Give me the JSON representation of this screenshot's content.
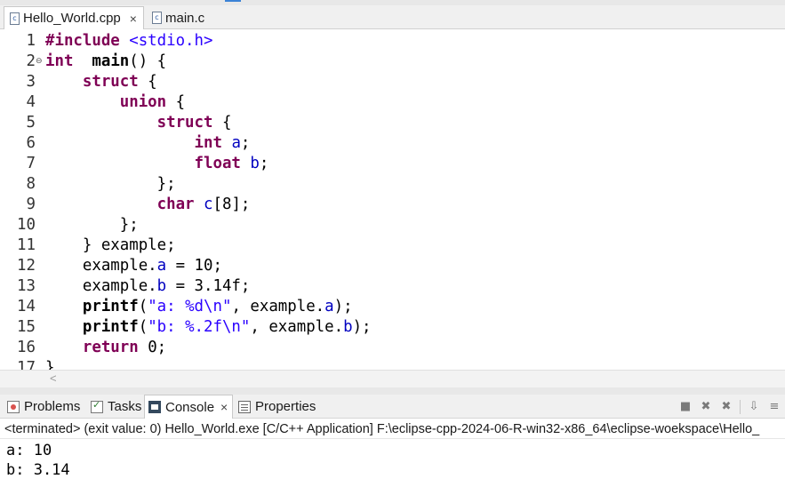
{
  "editor_tabs": [
    {
      "label": "Hello_World.cpp",
      "icon": "c-source-file-icon",
      "active": true
    },
    {
      "label": "main.c",
      "icon": "c-source-file-icon",
      "active": false
    }
  ],
  "tab_icon_glyph": "c",
  "tab_close_glyph": "×",
  "code": [
    {
      "n": "1",
      "tokens": [
        [
          "pp",
          "#include "
        ],
        [
          "str",
          "<stdio.h>"
        ]
      ]
    },
    {
      "n": "2",
      "fold": "⊖",
      "tokens": [
        [
          "kw",
          "int"
        ],
        [
          "",
          "  "
        ],
        [
          "fn",
          "main"
        ],
        [
          "",
          "() {"
        ]
      ]
    },
    {
      "n": "3",
      "tokens": [
        [
          "",
          "    "
        ],
        [
          "kw",
          "struct"
        ],
        [
          "",
          " {"
        ]
      ]
    },
    {
      "n": "4",
      "tokens": [
        [
          "",
          "        "
        ],
        [
          "kw",
          "union"
        ],
        [
          "",
          " {"
        ]
      ]
    },
    {
      "n": "5",
      "tokens": [
        [
          "",
          "            "
        ],
        [
          "kw",
          "struct"
        ],
        [
          "",
          " {"
        ]
      ]
    },
    {
      "n": "6",
      "tokens": [
        [
          "",
          "                "
        ],
        [
          "kw",
          "int"
        ],
        [
          "",
          " "
        ],
        [
          "fld",
          "a"
        ],
        [
          "",
          ";"
        ]
      ]
    },
    {
      "n": "7",
      "tokens": [
        [
          "",
          "                "
        ],
        [
          "kw",
          "float"
        ],
        [
          "",
          " "
        ],
        [
          "fld",
          "b"
        ],
        [
          "",
          ";"
        ]
      ]
    },
    {
      "n": "8",
      "tokens": [
        [
          "",
          "            };"
        ]
      ]
    },
    {
      "n": "9",
      "tokens": [
        [
          "",
          "            "
        ],
        [
          "kw",
          "char"
        ],
        [
          "",
          " "
        ],
        [
          "fld",
          "c"
        ],
        [
          "",
          "[8];"
        ]
      ]
    },
    {
      "n": "10",
      "tokens": [
        [
          "",
          "        };"
        ]
      ]
    },
    {
      "n": "11",
      "tokens": [
        [
          "",
          "    } example;"
        ]
      ]
    },
    {
      "n": "12",
      "tokens": [
        [
          "",
          "    example."
        ],
        [
          "fld",
          "a"
        ],
        [
          "",
          " = 10;"
        ]
      ]
    },
    {
      "n": "13",
      "tokens": [
        [
          "",
          "    example."
        ],
        [
          "fld",
          "b"
        ],
        [
          "",
          " = 3.14f;"
        ]
      ]
    },
    {
      "n": "14",
      "tokens": [
        [
          "",
          "    "
        ],
        [
          "fn",
          "printf"
        ],
        [
          "",
          "("
        ],
        [
          "str",
          "\"a: %d\\n\""
        ],
        [
          "",
          ", example."
        ],
        [
          "fld",
          "a"
        ],
        [
          "",
          ");"
        ]
      ]
    },
    {
      "n": "15",
      "tokens": [
        [
          "",
          "    "
        ],
        [
          "fn",
          "printf"
        ],
        [
          "",
          "("
        ],
        [
          "str",
          "\"b: %.2f\\n\""
        ],
        [
          "",
          ", example."
        ],
        [
          "fld",
          "b"
        ],
        [
          "",
          ");"
        ]
      ]
    },
    {
      "n": "16",
      "tokens": [
        [
          "",
          "    "
        ],
        [
          "kw",
          "return"
        ],
        [
          "",
          " 0;"
        ]
      ]
    },
    {
      "n": "17",
      "tokens": [
        [
          "",
          "}"
        ]
      ]
    }
  ],
  "scroll_left_glyph": "<",
  "views": [
    {
      "label": "Problems",
      "icon": "problems-icon",
      "active": false
    },
    {
      "label": "Tasks",
      "icon": "tasks-icon",
      "active": false
    },
    {
      "label": "Console",
      "icon": "console-icon",
      "active": true
    },
    {
      "label": "Properties",
      "icon": "properties-icon",
      "active": false
    }
  ],
  "view_close_glyph": "×",
  "console_toolbar": [
    {
      "name": "terminate-icon",
      "glyph": "■"
    },
    {
      "name": "remove-launch-icon",
      "glyph": "✖"
    },
    {
      "name": "remove-all-terminated-icon",
      "glyph": "✖"
    },
    {
      "name": "separator",
      "glyph": ""
    },
    {
      "name": "scroll-lock-icon",
      "glyph": "⇩"
    },
    {
      "name": "word-wrap-icon",
      "glyph": "≡"
    }
  ],
  "console": {
    "status": "<terminated> (exit value: 0) Hello_World.exe [C/C++ Application] F:\\eclipse-cpp-2024-06-R-win32-x86_64\\eclipse-woekspace\\Hello_",
    "output": [
      "a: 10",
      "b: 3.14"
    ]
  },
  "colors": {
    "keyword": "#7f0055",
    "string": "#2a00ff",
    "field": "#0000c0",
    "tab_bar_bg": "#f0f0f0"
  }
}
